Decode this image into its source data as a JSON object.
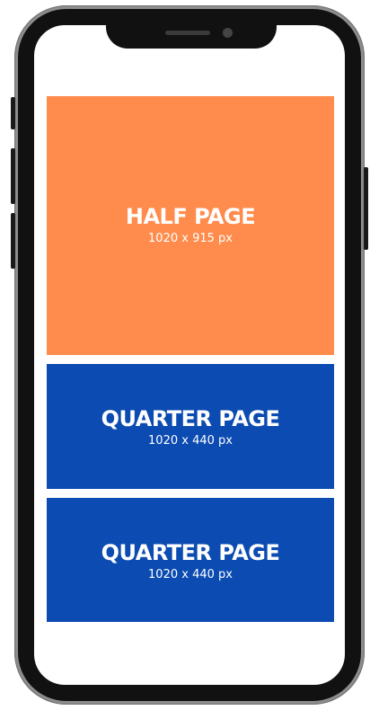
{
  "ad_placements": [
    {
      "title": "HALF PAGE",
      "size": "1020 x 915 px",
      "color": "#ff8c4c"
    },
    {
      "title": "QUARTER PAGE",
      "size": "1020 x 440 px",
      "color": "#0c4bb1"
    },
    {
      "title": "QUARTER PAGE",
      "size": "1020 x 440 px",
      "color": "#0c4bb1"
    }
  ],
  "device": {
    "frame_color": "#8d8d8d",
    "bezel_color": "#111111",
    "screen_color": "#ffffff"
  }
}
